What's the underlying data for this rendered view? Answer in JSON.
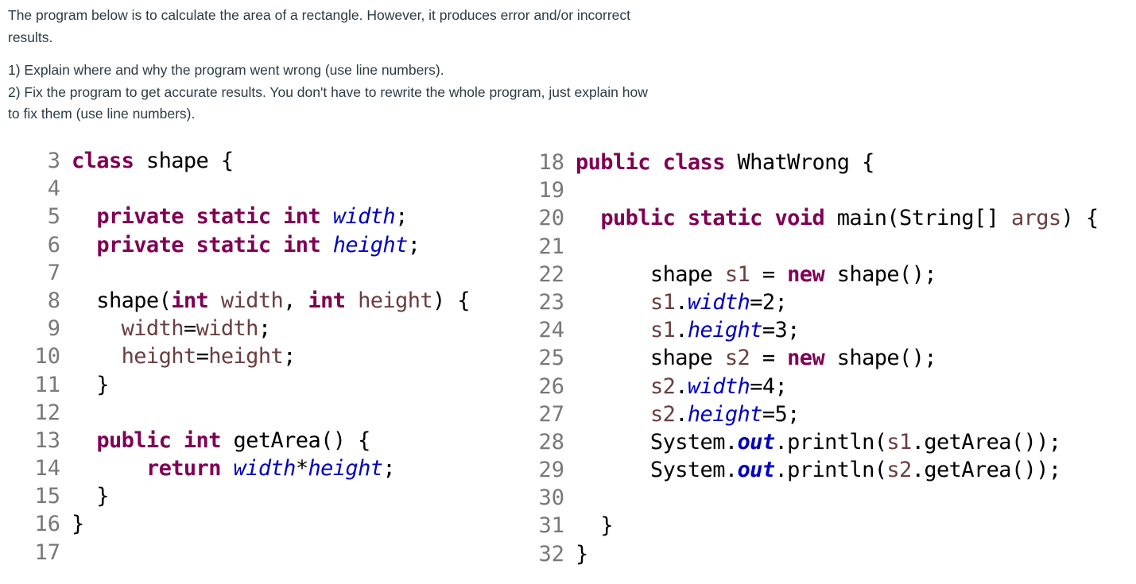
{
  "prompt": {
    "intro": "The program below is to calculate the area of a rectangle. However, it produces error and/or incorrect results.",
    "q1": "1) Explain where and why the program went wrong (use line numbers).",
    "q2": "2) Fix the program to get accurate results. You don't have to rewrite the whole program, just explain how to fix them (use line numbers)."
  },
  "code_left": {
    "lines": [
      {
        "n": "3",
        "tokens": [
          {
            "t": "class",
            "c": "kw"
          },
          {
            "t": " shape {",
            "c": ""
          }
        ]
      },
      {
        "n": "4",
        "tokens": []
      },
      {
        "n": "5",
        "tokens": [
          {
            "t": "  ",
            "c": ""
          },
          {
            "t": "private",
            "c": "kw"
          },
          {
            "t": " ",
            "c": ""
          },
          {
            "t": "static",
            "c": "kw"
          },
          {
            "t": " ",
            "c": ""
          },
          {
            "t": "int",
            "c": "kw"
          },
          {
            "t": " ",
            "c": ""
          },
          {
            "t": "width",
            "c": "fld"
          },
          {
            "t": ";",
            "c": ""
          }
        ]
      },
      {
        "n": "6",
        "tokens": [
          {
            "t": "  ",
            "c": ""
          },
          {
            "t": "private",
            "c": "kw"
          },
          {
            "t": " ",
            "c": ""
          },
          {
            "t": "static",
            "c": "kw"
          },
          {
            "t": " ",
            "c": ""
          },
          {
            "t": "int",
            "c": "kw"
          },
          {
            "t": " ",
            "c": ""
          },
          {
            "t": "height",
            "c": "fld"
          },
          {
            "t": ";",
            "c": ""
          }
        ]
      },
      {
        "n": "7",
        "tokens": []
      },
      {
        "n": "8",
        "tokens": [
          {
            "t": "  shape(",
            "c": ""
          },
          {
            "t": "int",
            "c": "kw"
          },
          {
            "t": " ",
            "c": ""
          },
          {
            "t": "width",
            "c": "loc"
          },
          {
            "t": ", ",
            "c": ""
          },
          {
            "t": "int",
            "c": "kw"
          },
          {
            "t": " ",
            "c": ""
          },
          {
            "t": "height",
            "c": "loc"
          },
          {
            "t": ") {",
            "c": ""
          }
        ]
      },
      {
        "n": "9",
        "tokens": [
          {
            "t": "    ",
            "c": ""
          },
          {
            "t": "width",
            "c": "loc"
          },
          {
            "t": "=",
            "c": ""
          },
          {
            "t": "width",
            "c": "loc"
          },
          {
            "t": ";",
            "c": ""
          }
        ]
      },
      {
        "n": "10",
        "tokens": [
          {
            "t": "    ",
            "c": ""
          },
          {
            "t": "height",
            "c": "loc"
          },
          {
            "t": "=",
            "c": ""
          },
          {
            "t": "height",
            "c": "loc"
          },
          {
            "t": ";",
            "c": ""
          }
        ]
      },
      {
        "n": "11",
        "tokens": [
          {
            "t": "  }",
            "c": ""
          }
        ]
      },
      {
        "n": "12",
        "tokens": []
      },
      {
        "n": "13",
        "tokens": [
          {
            "t": "  ",
            "c": ""
          },
          {
            "t": "public",
            "c": "kw"
          },
          {
            "t": " ",
            "c": ""
          },
          {
            "t": "int",
            "c": "kw"
          },
          {
            "t": " getArea() {",
            "c": ""
          }
        ]
      },
      {
        "n": "14",
        "tokens": [
          {
            "t": "      ",
            "c": ""
          },
          {
            "t": "return",
            "c": "kw"
          },
          {
            "t": " ",
            "c": ""
          },
          {
            "t": "width",
            "c": "fld"
          },
          {
            "t": "*",
            "c": ""
          },
          {
            "t": "height",
            "c": "fld"
          },
          {
            "t": ";",
            "c": ""
          }
        ]
      },
      {
        "n": "15",
        "tokens": [
          {
            "t": "  }",
            "c": ""
          }
        ]
      },
      {
        "n": "16",
        "tokens": [
          {
            "t": "}",
            "c": ""
          }
        ]
      },
      {
        "n": "17",
        "tokens": []
      }
    ]
  },
  "code_right": {
    "lines": [
      {
        "n": "18",
        "tokens": [
          {
            "t": "public",
            "c": "kw"
          },
          {
            "t": " ",
            "c": ""
          },
          {
            "t": "class",
            "c": "kw"
          },
          {
            "t": " WhatWrong {",
            "c": ""
          }
        ]
      },
      {
        "n": "19",
        "tokens": []
      },
      {
        "n": "20",
        "tokens": [
          {
            "t": "  ",
            "c": ""
          },
          {
            "t": "public",
            "c": "kw"
          },
          {
            "t": " ",
            "c": ""
          },
          {
            "t": "static",
            "c": "kw"
          },
          {
            "t": " ",
            "c": ""
          },
          {
            "t": "void",
            "c": "kw"
          },
          {
            "t": " main(String[] ",
            "c": ""
          },
          {
            "t": "args",
            "c": "loc"
          },
          {
            "t": ") {",
            "c": ""
          }
        ]
      },
      {
        "n": "21",
        "tokens": []
      },
      {
        "n": "22",
        "tokens": [
          {
            "t": "      shape ",
            "c": ""
          },
          {
            "t": "s1",
            "c": "loc"
          },
          {
            "t": " = ",
            "c": ""
          },
          {
            "t": "new",
            "c": "kw"
          },
          {
            "t": " shape();",
            "c": ""
          }
        ]
      },
      {
        "n": "23",
        "tokens": [
          {
            "t": "      ",
            "c": ""
          },
          {
            "t": "s1",
            "c": "loc"
          },
          {
            "t": ".",
            "c": ""
          },
          {
            "t": "width",
            "c": "fld"
          },
          {
            "t": "=2;",
            "c": ""
          }
        ]
      },
      {
        "n": "24",
        "tokens": [
          {
            "t": "      ",
            "c": ""
          },
          {
            "t": "s1",
            "c": "loc"
          },
          {
            "t": ".",
            "c": ""
          },
          {
            "t": "height",
            "c": "fld"
          },
          {
            "t": "=3;",
            "c": ""
          }
        ]
      },
      {
        "n": "25",
        "tokens": [
          {
            "t": "      shape ",
            "c": ""
          },
          {
            "t": "s2",
            "c": "loc"
          },
          {
            "t": " = ",
            "c": ""
          },
          {
            "t": "new",
            "c": "kw"
          },
          {
            "t": " shape();",
            "c": ""
          }
        ]
      },
      {
        "n": "26",
        "tokens": [
          {
            "t": "      ",
            "c": ""
          },
          {
            "t": "s2",
            "c": "loc"
          },
          {
            "t": ".",
            "c": ""
          },
          {
            "t": "width",
            "c": "fld"
          },
          {
            "t": "=4;",
            "c": ""
          }
        ]
      },
      {
        "n": "27",
        "tokens": [
          {
            "t": "      ",
            "c": ""
          },
          {
            "t": "s2",
            "c": "loc"
          },
          {
            "t": ".",
            "c": ""
          },
          {
            "t": "height",
            "c": "fld"
          },
          {
            "t": "=5;",
            "c": ""
          }
        ]
      },
      {
        "n": "28",
        "tokens": [
          {
            "t": "      System.",
            "c": ""
          },
          {
            "t": "out",
            "c": "sfld"
          },
          {
            "t": ".println(",
            "c": ""
          },
          {
            "t": "s1",
            "c": "loc"
          },
          {
            "t": ".getArea());",
            "c": ""
          }
        ]
      },
      {
        "n": "29",
        "tokens": [
          {
            "t": "      System.",
            "c": ""
          },
          {
            "t": "out",
            "c": "sfld"
          },
          {
            "t": ".println(",
            "c": ""
          },
          {
            "t": "s2",
            "c": "loc"
          },
          {
            "t": ".getArea());",
            "c": ""
          }
        ]
      },
      {
        "n": "30",
        "tokens": []
      },
      {
        "n": "31",
        "tokens": [
          {
            "t": "  }",
            "c": ""
          }
        ]
      },
      {
        "n": "32",
        "tokens": [
          {
            "t": "}",
            "c": ""
          }
        ]
      }
    ]
  }
}
